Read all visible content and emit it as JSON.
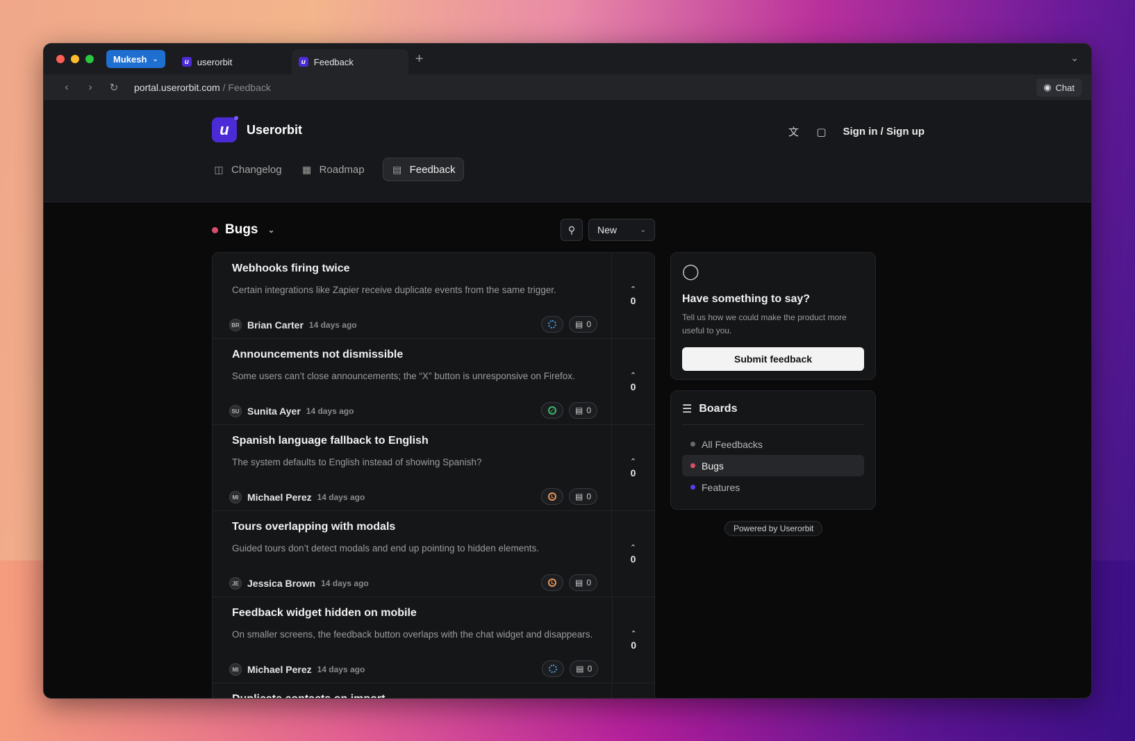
{
  "browser": {
    "profile": "Mukesh",
    "tabs": [
      {
        "label": "userorbit",
        "active": false
      },
      {
        "label": "Feedback",
        "active": true
      }
    ],
    "url_host": "portal.userorbit.com",
    "url_path": " / Feedback",
    "chat_label": "Chat"
  },
  "site": {
    "brand": "Userorbit",
    "signin": "Sign in / Sign up",
    "nav": [
      {
        "label": "Changelog",
        "icon": "gift-icon"
      },
      {
        "label": "Roadmap",
        "icon": "map-icon"
      },
      {
        "label": "Feedback",
        "icon": "message-icon",
        "active": true
      }
    ]
  },
  "board": {
    "title": "Bugs",
    "sort": "New"
  },
  "posts": [
    {
      "title": "Webhooks firing twice",
      "desc": "Certain integrations like Zapier receive duplicate events from the same trigger.",
      "initials": "BR",
      "author": "Brian Carter",
      "time": "14 days ago",
      "status": "in-progress",
      "comments": "0",
      "votes": "0"
    },
    {
      "title": "Announcements not dismissible",
      "desc": "Some users can’t close announcements; the “X” button is unresponsive on Firefox.",
      "initials": "SU",
      "author": "Sunita Ayer",
      "time": "14 days ago",
      "status": "done",
      "comments": "0",
      "votes": "0"
    },
    {
      "title": "Spanish language fallback to English",
      "desc": "The system defaults to English instead of showing Spanish?",
      "initials": "MI",
      "author": "Michael Perez",
      "time": "14 days ago",
      "status": "planned",
      "comments": "0",
      "votes": "0"
    },
    {
      "title": "Tours overlapping with modals",
      "desc": "Guided tours don’t detect modals and end up pointing to hidden elements.",
      "initials": "JE",
      "author": "Jessica Brown",
      "time": "14 days ago",
      "status": "planned",
      "comments": "0",
      "votes": "0"
    },
    {
      "title": "Feedback widget hidden on mobile",
      "desc": "On smaller screens, the feedback button overlaps with the chat widget and disappears.",
      "initials": "MI",
      "author": "Michael Perez",
      "time": "14 days ago",
      "status": "in-progress",
      "comments": "0",
      "votes": "0"
    },
    {
      "title": "Duplicate contacts on import",
      "desc": "",
      "initials": "",
      "author": "",
      "time": "",
      "status": "",
      "comments": "",
      "votes": ""
    }
  ],
  "sidebar": {
    "say_title": "Have something to say?",
    "say_text": "Tell us how we could make the product more useful to you.",
    "submit_label": "Submit feedback",
    "boards_title": "Boards",
    "boards": [
      {
        "label": "All Feedbacks",
        "color": "#6b6b6b"
      },
      {
        "label": "Bugs",
        "color": "#d94e6a",
        "active": true
      },
      {
        "label": "Features",
        "color": "#5b3df0"
      }
    ],
    "powered": "Powered by Userorbit"
  },
  "colors": {
    "accent": "#4b2bd6",
    "bug": "#d94e6a",
    "profile": "#1f6fd0"
  }
}
